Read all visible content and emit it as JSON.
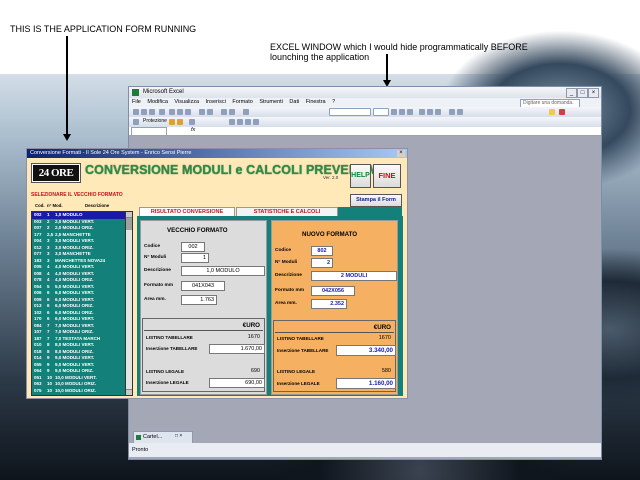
{
  "annotations": {
    "left": "THIS IS THE APPLICATION FORM RUNNING",
    "right": "EXCEL WINDOW which I would hide programmatically BEFORE lounching the application"
  },
  "excel": {
    "title": "Microsoft Excel",
    "menu": [
      "File",
      "Modifica",
      "Visualizza",
      "Inserisci",
      "Formato",
      "Strumenti",
      "Dati",
      "Finestra",
      "?"
    ],
    "help_placeholder": "Digitare una domanda.",
    "toolbar_protezione": "Protezione",
    "fx": "fx",
    "status": "Pronto",
    "mini_window": "Cartel..."
  },
  "app": {
    "title": "Conversione Formati - Il Sole 24 Ore System - Enrico Sensi Pierre",
    "logo": "24 ORE",
    "headline": "CONVERSIONE MODULI e CALCOLI PREVENTIVI",
    "version": "Ver. 2.0",
    "buttons": {
      "help": "HELP",
      "fine": "FINE",
      "stampa": "Stampa il Form"
    },
    "left_title": "SELEZIONARE IL VECCHIO FORMATO",
    "left_headers": [
      "Cod.",
      "n° Mod.",
      "Descrizione"
    ],
    "list": [
      [
        "002",
        "1",
        "1,0 MODULO"
      ],
      [
        "003",
        "2",
        "2,0 MODULI VERT."
      ],
      [
        "007",
        "2",
        "2,0 MODULI ORIZ."
      ],
      [
        "177",
        "2,5",
        "2,5 MANCHETTE"
      ],
      [
        "004",
        "3",
        "3,0 MODULI VERT."
      ],
      [
        "012",
        "3",
        "3,0 MODULI ORIZ."
      ],
      [
        "077",
        "3",
        "3,0 MANCHETTE"
      ],
      [
        "183",
        "3",
        "MANCHETTES NOVA24"
      ],
      [
        "005",
        "4",
        "4,0 MODULI VERT."
      ],
      [
        "008",
        "4",
        "4,0 MODULI VERT."
      ],
      [
        "078",
        "4",
        "4,0 MODULI ORIZ."
      ],
      [
        "054",
        "5",
        "5,0 MODULI VERT."
      ],
      [
        "006",
        "6",
        "6,0 MODULI VERT."
      ],
      [
        "009",
        "6",
        "6,0 MODULI VERT."
      ],
      [
        "013",
        "6",
        "6,0 MODULI ORIZ."
      ],
      [
        "102",
        "6",
        "6,0 MODULI ORIZ."
      ],
      [
        "170",
        "6",
        "6,0 MODULI VERT."
      ],
      [
        "084",
        "7",
        "7,0 MODULI VERT."
      ],
      [
        "107",
        "7",
        "7,0 MODULI ORIZ."
      ],
      [
        "187",
        "7",
        "7,0 TESTATA MARCH"
      ],
      [
        "010",
        "8",
        "8,0 MODULI VERT."
      ],
      [
        "018",
        "8",
        "8,0 MODULI ORIZ."
      ],
      [
        "014",
        "9",
        "9,0 MODULI VERT."
      ],
      [
        "055",
        "9",
        "9,0 MODULI VERT."
      ],
      [
        "064",
        "9",
        "9,0 MODULI ORIZ."
      ],
      [
        "051",
        "10",
        "10,0 MODULI VERT."
      ],
      [
        "063",
        "10",
        "10,0 MODULI ORIZ."
      ],
      [
        "075",
        "10",
        "10,0 MODULI ORIZ."
      ]
    ],
    "tabs": [
      "RISULTATO CONVERSIONE",
      "STATISTICHE E CALCOLI"
    ],
    "vecchio": {
      "title": "VECCHIO FORMATO",
      "codice_label": "Codice",
      "codice": "002",
      "moduli_label": "N° Moduli",
      "moduli": "1",
      "desc_label": "Descrizione",
      "desc": "1,0 MODULO",
      "formato_label": "Formato mm",
      "formato": "041X043",
      "area_label": "Area mm.",
      "area": "1.763",
      "euro": "€URO",
      "listino_tab_label": "LISTINO TABELLARE",
      "listino_tab": "1670",
      "ins_tab_label": "Inserzione TABELLARE",
      "ins_tab": "1.670,00",
      "listino_leg_label": "LISTINO LEGALE",
      "listino_leg": "690",
      "ins_leg_label": "Inserzione LEGALE",
      "ins_leg": "690,00"
    },
    "nuovo": {
      "title": "NUOVO FORMATO",
      "codice_label": "Codice",
      "codice": "802",
      "moduli_label": "N° Moduli",
      "moduli": "2",
      "desc_label": "Descrizione",
      "desc": "2 MODULI",
      "formato_label": "Formato mm",
      "formato": "042X056",
      "area_label": "Area mm.",
      "area": "2.352",
      "euro": "€URO",
      "listino_tab_label": "LISTINO TABELLARE",
      "listino_tab": "1670",
      "ins_tab_label": "Inserzione TABELLARE",
      "ins_tab": "3.340,00",
      "listino_leg_label": "LISTINO LEGALE",
      "listino_leg": "580",
      "ins_leg_label": "Inserzione LEGALE",
      "ins_leg": "1.160,00"
    }
  }
}
